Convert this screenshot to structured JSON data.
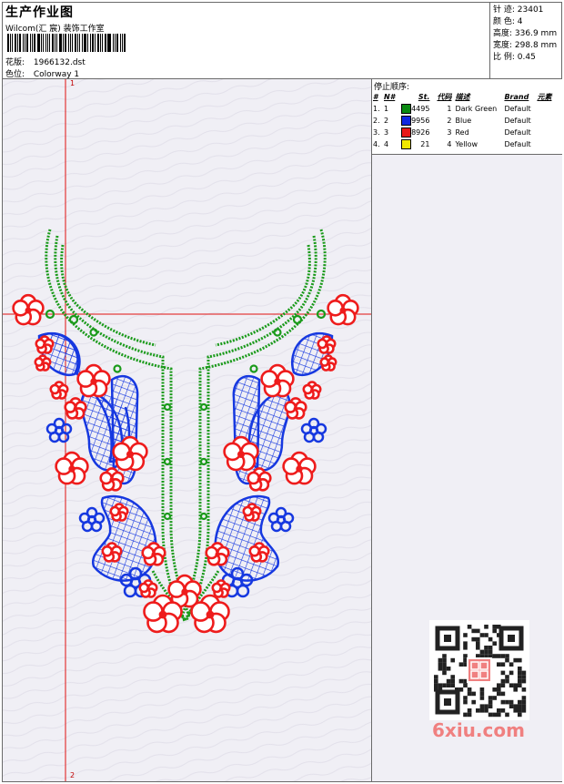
{
  "header": {
    "title": "生产作业图",
    "studio": "Wilcom(汇 宸) 装饰工作室",
    "pattern_label": "花版:",
    "pattern_value": "1966132.dst",
    "colorway_label": "色位:",
    "colorway_value": "Colorway 1"
  },
  "stats": [
    {
      "label": "针 迹:",
      "value": "23401"
    },
    {
      "label": "颜 色:",
      "value": "4"
    },
    {
      "label": "高度:",
      "value": "336.9 mm"
    },
    {
      "label": "宽度:",
      "value": "298.8 mm"
    },
    {
      "label": "比 例:",
      "value": "0.45"
    }
  ],
  "stop_sequence": {
    "title": "停止顺序:",
    "headers": [
      "#",
      "N#",
      "St.",
      "代码",
      "描述",
      "Brand",
      "元素"
    ],
    "rows": [
      {
        "idx": "1.",
        "n": "1",
        "color": "#0a8a12",
        "st": "4495",
        "code": "1",
        "desc": "Dark Green",
        "brand": "Default"
      },
      {
        "idx": "2.",
        "n": "2",
        "color": "#1028e0",
        "st": "9956",
        "code": "2",
        "desc": "Blue",
        "brand": "Default"
      },
      {
        "idx": "3.",
        "n": "3",
        "color": "#e81818",
        "st": "8926",
        "code": "3",
        "desc": "Red",
        "brand": "Default"
      },
      {
        "idx": "4.",
        "n": "4",
        "color": "#f0e800",
        "st": "21",
        "code": "4",
        "desc": "Yellow",
        "brand": "Default"
      }
    ]
  },
  "guide_markers": {
    "top": "1",
    "bottom": "2"
  },
  "watermark": "6xiu.com",
  "colors": {
    "green": "#1a9a1a",
    "blue": "#1638e0",
    "red": "#ee1c1c",
    "guide": "#e01010"
  }
}
